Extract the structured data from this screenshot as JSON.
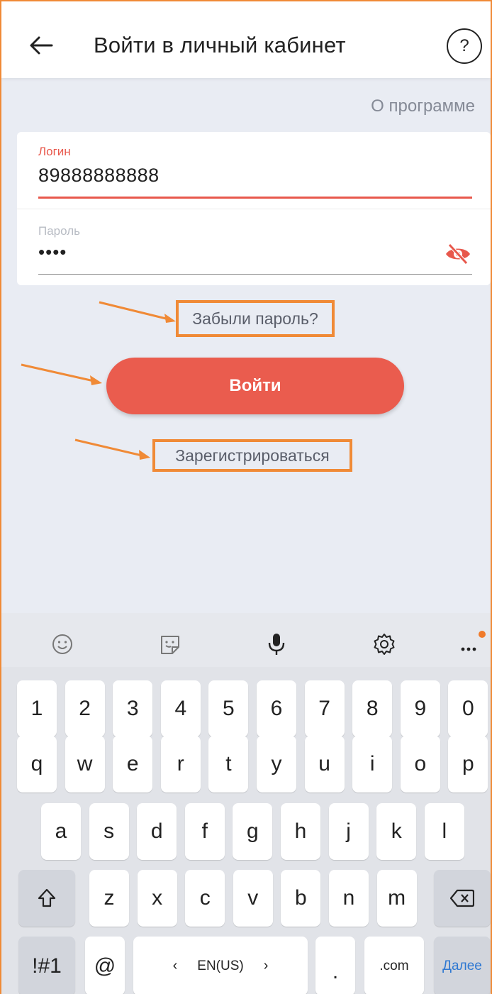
{
  "header": {
    "title": "Войти в личный кабинет",
    "help_label": "?"
  },
  "about_link": "О программе",
  "login": {
    "label": "Логин",
    "value": "89888888888"
  },
  "password": {
    "label": "Пароль",
    "value": "••••"
  },
  "forgot_link": "Забыли пароль?",
  "login_button": "Войти",
  "register_link": "Зарегистрироваться",
  "keyboard": {
    "row_numbers": [
      "1",
      "2",
      "3",
      "4",
      "5",
      "6",
      "7",
      "8",
      "9",
      "0"
    ],
    "row_top": [
      "q",
      "w",
      "e",
      "r",
      "t",
      "y",
      "u",
      "i",
      "o",
      "p"
    ],
    "row_mid": [
      "a",
      "s",
      "d",
      "f",
      "g",
      "h",
      "j",
      "k",
      "l"
    ],
    "row_bottom": [
      "z",
      "x",
      "c",
      "v",
      "b",
      "n",
      "m"
    ],
    "symbols_key": "!#1",
    "at_key": "@",
    "language": "EN(US)",
    "period_key": ".",
    "com_key": ".com",
    "action_key": "Далее"
  },
  "colors": {
    "accent": "#ea5c4e",
    "annotation": "#f08a36",
    "background": "#e9ecf3"
  }
}
